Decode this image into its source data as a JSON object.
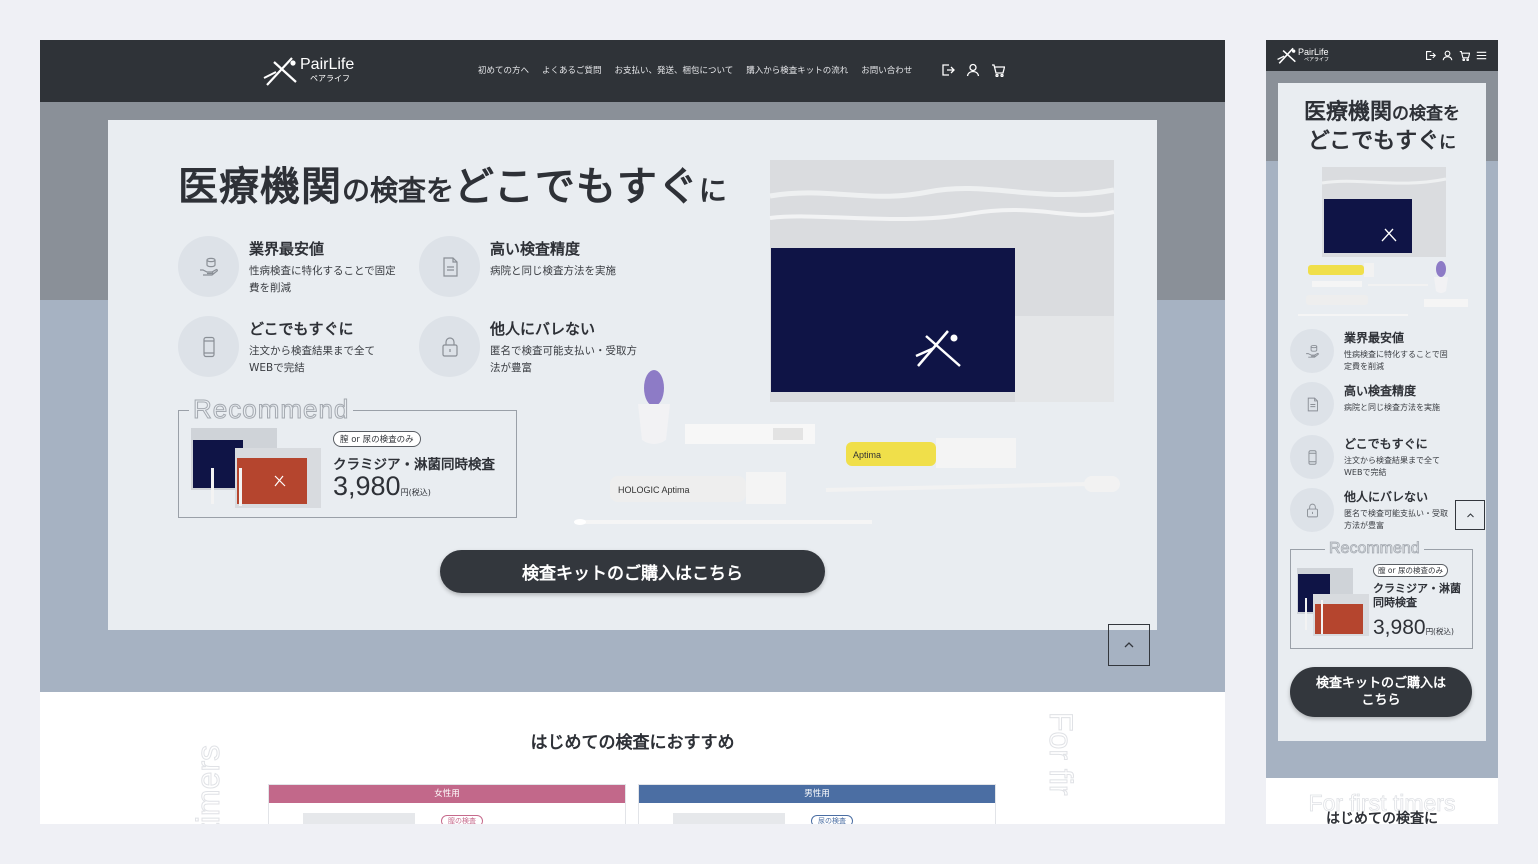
{
  "brand": {
    "name": "PairLife",
    "kana": "ペアライフ"
  },
  "nav": [
    "初めての方へ",
    "よくあるご質問",
    "お支払い、発送、梱包について",
    "購入から検査キットの流れ",
    "お問い合わせ"
  ],
  "header_icons": [
    "logout-icon",
    "user-icon",
    "cart-icon",
    "menu-icon"
  ],
  "hero": {
    "headline_a": "医療機関",
    "headline_b": "の検査を",
    "headline_c": "どこでもすぐ",
    "headline_d": "に",
    "features": [
      {
        "icon": "coin-hand-icon",
        "title": "業界最安値",
        "desc": "性病検査に特化することで固定費を削減"
      },
      {
        "icon": "document-icon",
        "title": "高い検査精度",
        "desc": "病院と同じ検査方法を実施"
      },
      {
        "icon": "smartphone-icon",
        "title": "どこでもすぐに",
        "desc": "注文から検査結果まで全てWEBで完結"
      },
      {
        "icon": "lock-icon",
        "title": "他人にバレない",
        "desc": "匿名で検査可能支払い・受取方法が豊富"
      }
    ],
    "recommend": {
      "label": "Recommend",
      "tag": "膣 or 尿の検査のみ",
      "product": "クラミジア・淋菌同時検査",
      "price": "3,980",
      "price_unit": "円(税込)"
    },
    "cta": "検査キットのご購入はこちら",
    "mobile_cta": "検査キットのご購入はこちら"
  },
  "first_timers": {
    "ghost": "For first timers",
    "ghost_left": "timers",
    "ghost_right": "For fir",
    "title": "はじめての検査におすすめ",
    "mobile_title": "はじめての検査に",
    "cards": [
      {
        "label": "女性用",
        "tag": "膣の検査",
        "color": "#c2688a"
      },
      {
        "label": "男性用",
        "tag": "尿の検査",
        "color": "#4b6ea3"
      }
    ]
  },
  "colors": {
    "header": "#2f3338",
    "band_top": "#8a9098",
    "band_bottom": "#a6b2c2",
    "card": "#e9edf1",
    "kit_navy": "#0f1446"
  }
}
